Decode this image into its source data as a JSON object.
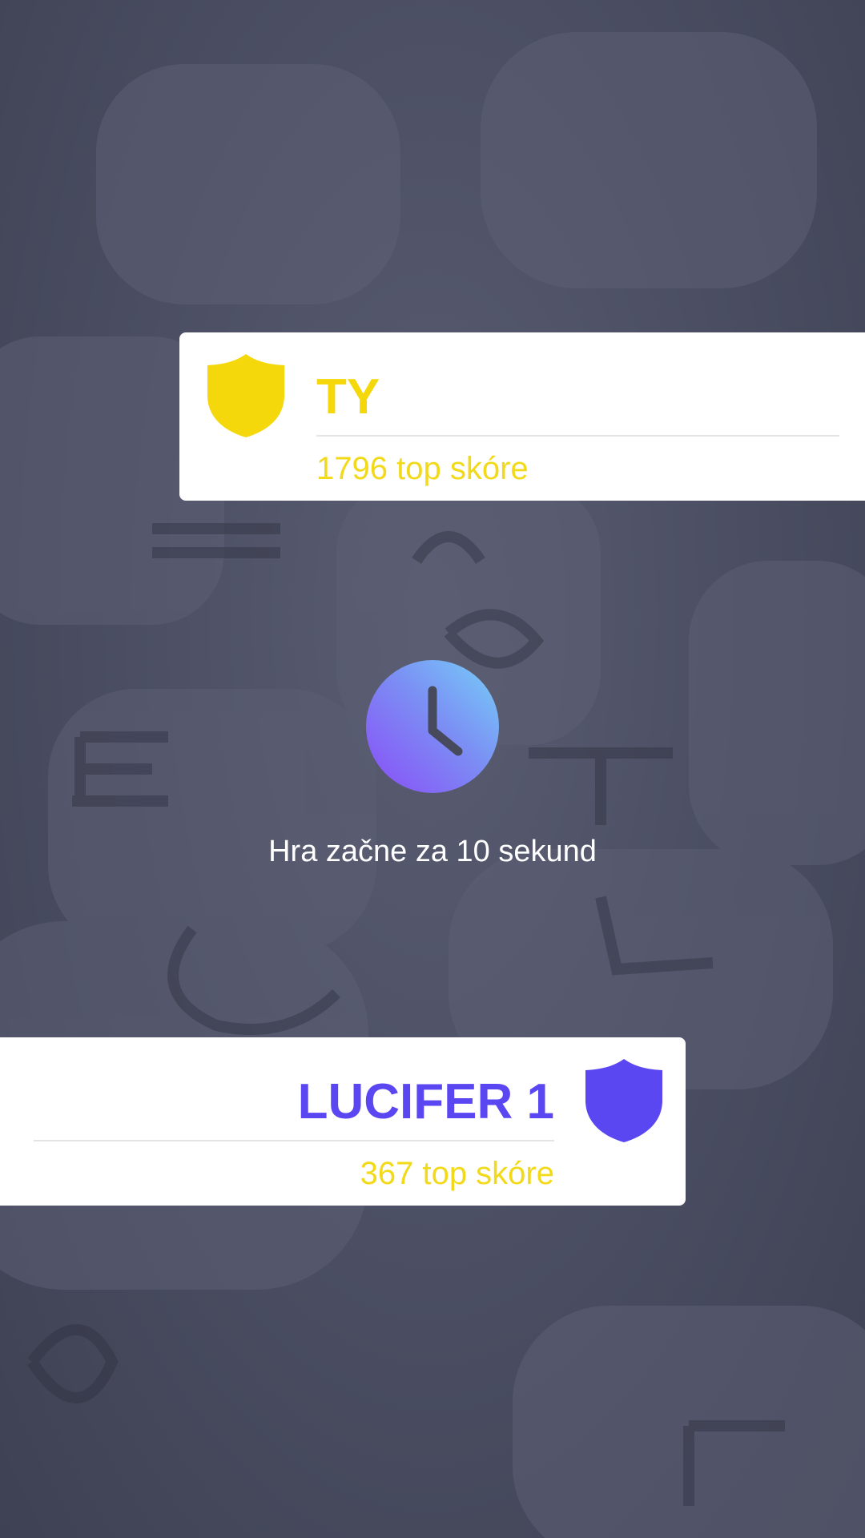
{
  "players": {
    "you": {
      "name": "TY",
      "score_text": "1796 top skóre",
      "color": "#f5d80c"
    },
    "opponent": {
      "name": "LUCIFER 1",
      "score_text": "367 top skóre",
      "color": "#5b47f2"
    }
  },
  "countdown": {
    "text": "Hra začne za 10 sekund",
    "icon": "clock-icon"
  },
  "colors": {
    "overlay": "#4d5064",
    "card": "#ffffff",
    "score_text": "#f2d91a",
    "timer_gradient_start": "#8a4cf7",
    "timer_gradient_end": "#76d0f8"
  }
}
